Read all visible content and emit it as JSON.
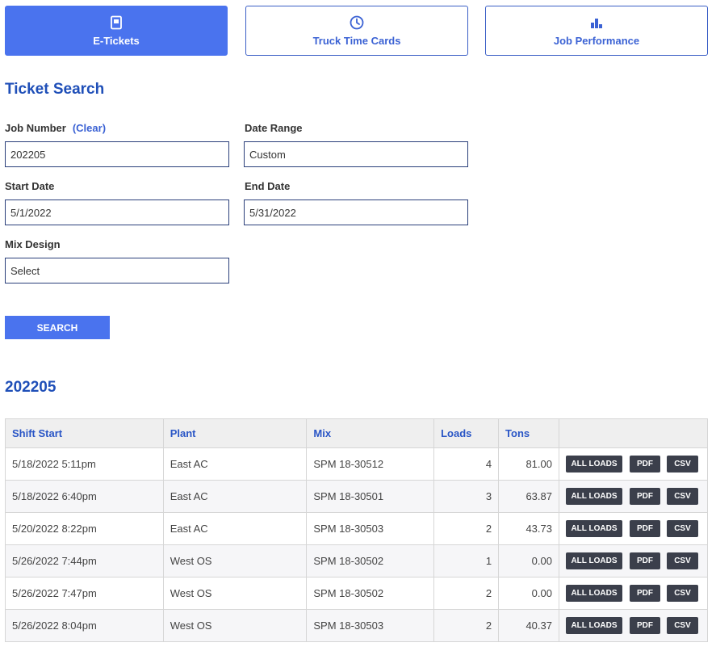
{
  "tabs": [
    {
      "label": "E-Tickets",
      "icon": "ticket-icon",
      "active": true
    },
    {
      "label": "Truck Time Cards",
      "icon": "clock-icon",
      "active": false
    },
    {
      "label": "Job Performance",
      "icon": "bar-chart-icon",
      "active": false
    }
  ],
  "search": {
    "title": "Ticket Search",
    "job_number_label": "Job Number",
    "clear_label": "(Clear)",
    "job_number_value": "202205",
    "date_range_label": "Date Range",
    "date_range_value": "Custom",
    "start_date_label": "Start Date",
    "start_date_value": "5/1/2022",
    "end_date_label": "End Date",
    "end_date_value": "5/31/2022",
    "mix_design_label": "Mix Design",
    "mix_design_value": "Select",
    "search_button": "SEARCH"
  },
  "results": {
    "title": "202205",
    "columns": [
      "Shift Start",
      "Plant",
      "Mix",
      "Loads",
      "Tons",
      ""
    ],
    "action_labels": {
      "all_loads": "ALL LOADS",
      "pdf": "PDF",
      "csv": "CSV"
    },
    "rows": [
      {
        "shift_start": "5/18/2022 5:11pm",
        "plant": "East AC",
        "mix": "SPM 18-30512",
        "loads": "4",
        "tons": "81.00"
      },
      {
        "shift_start": "5/18/2022 6:40pm",
        "plant": "East AC",
        "mix": "SPM 18-30501",
        "loads": "3",
        "tons": "63.87"
      },
      {
        "shift_start": "5/20/2022 8:22pm",
        "plant": "East AC",
        "mix": "SPM 18-30503",
        "loads": "2",
        "tons": "43.73"
      },
      {
        "shift_start": "5/26/2022 7:44pm",
        "plant": "West OS",
        "mix": "SPM 18-30502",
        "loads": "1",
        "tons": "0.00"
      },
      {
        "shift_start": "5/26/2022 7:47pm",
        "plant": "West OS",
        "mix": "SPM 18-30502",
        "loads": "2",
        "tons": "0.00"
      },
      {
        "shift_start": "5/26/2022 8:04pm",
        "plant": "West OS",
        "mix": "SPM 18-30503",
        "loads": "2",
        "tons": "40.37"
      }
    ]
  }
}
